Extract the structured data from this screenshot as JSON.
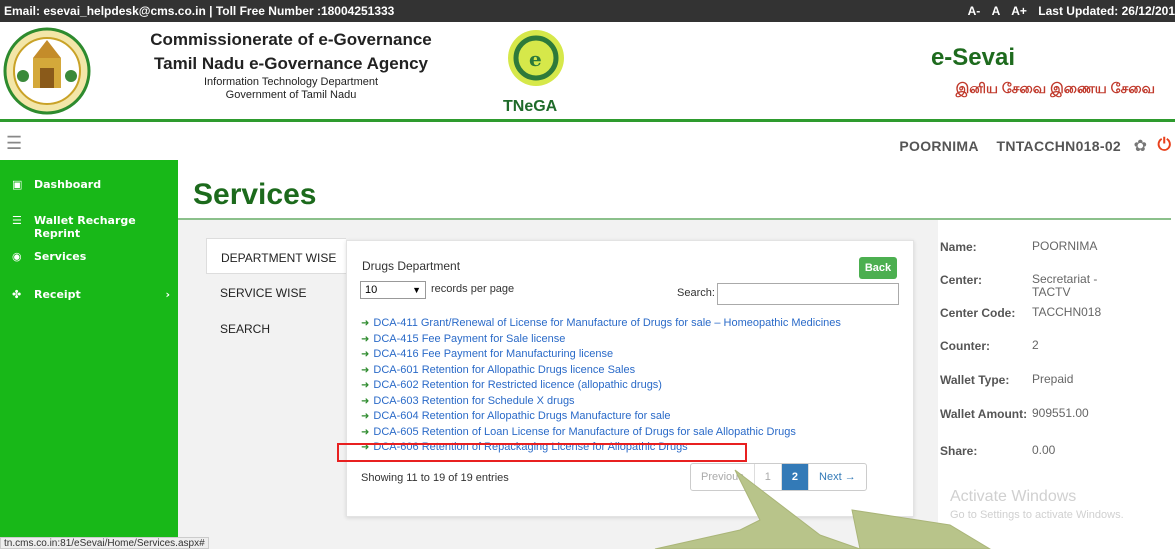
{
  "topbar": {
    "contact": "Email: esevai_helpdesk@cms.co.in | Toll Free Number :18004251333",
    "font_small": "A-",
    "font_normal": "A",
    "font_large": "A+",
    "last_updated": "Last Updated: 26/12/201"
  },
  "header": {
    "org_line1": "Commissionerate of e-Governance",
    "org_line2": "Tamil Nadu e-Governance Agency",
    "org_line3": "Information Technology Department",
    "org_line4": "Government of Tamil Nadu",
    "tnega": "TNeGA",
    "brand": "e-Sevai",
    "brand_tamil": "இனிய சேவை இணைய சேவை"
  },
  "navbar": {
    "user": "POORNIMA",
    "center_id": "TNTACCHN018-02"
  },
  "sidebar": {
    "items": [
      {
        "label": "Dashboard",
        "icon": "dashboard-icon"
      },
      {
        "label": "Wallet Recharge Reprint",
        "icon": "wallet-icon"
      },
      {
        "label": "Services",
        "icon": "services-icon"
      },
      {
        "label": "Receipt",
        "icon": "receipt-icon",
        "chevron": "›"
      }
    ]
  },
  "main": {
    "title": "Services",
    "tabs": [
      "DEPARTMENT WISE",
      "SERVICE WISE",
      "SEARCH"
    ],
    "department": "Drugs Department",
    "back_label": "Back",
    "length_value": "10",
    "length_label": "records per page",
    "search_label": "Search:",
    "services": [
      "DCA-411 Grant/Renewal of License for Manufacture of Drugs for sale – Homeopathic Medicines",
      "DCA-415 Fee Payment for Sale license",
      "DCA-416 Fee Payment for Manufacturing license",
      "DCA-601 Retention for Allopathic Drugs licence Sales",
      "DCA-602 Retention for Restricted licence (allopathic drugs)",
      "DCA-603 Retention for Schedule X drugs",
      "DCA-604 Retention for Allopathic Drugs Manufacture for sale",
      "DCA-605 Retention of Loan License for Manufacture of Drugs for sale Allopathic Drugs",
      "DCA-606 Retention of Repackaging License for Allopathic Drugs"
    ],
    "showing": "Showing 11 to 19 of 19 entries",
    "pager": {
      "previous": "Previous",
      "page1": "1",
      "page2": "2",
      "next": "Next →"
    }
  },
  "info": {
    "rows": [
      {
        "k": "Name:",
        "v": "POORNIMA"
      },
      {
        "k": "Center:",
        "v": "Secretariat - TACTV"
      },
      {
        "k": "Center Code:",
        "v": "TACCHN018"
      },
      {
        "k": "Counter:",
        "v": "2"
      },
      {
        "k": "Wallet Type:",
        "v": "Prepaid"
      },
      {
        "k": "Wallet Amount:",
        "v": "909551.00"
      },
      {
        "k": "Share:",
        "v": "0.00"
      }
    ]
  },
  "watermark": {
    "line1": "Activate Windows",
    "line2": "Go to Settings to activate Windows."
  },
  "statusbar": "tn.cms.co.in:81/eSevai/Home/Services.aspx#",
  "colors": {
    "sidebar": "#18b818",
    "title": "#1c6a1c",
    "link": "#2a6ac8",
    "highlight": "#e82020",
    "brand_tamil": "#c0392b"
  }
}
